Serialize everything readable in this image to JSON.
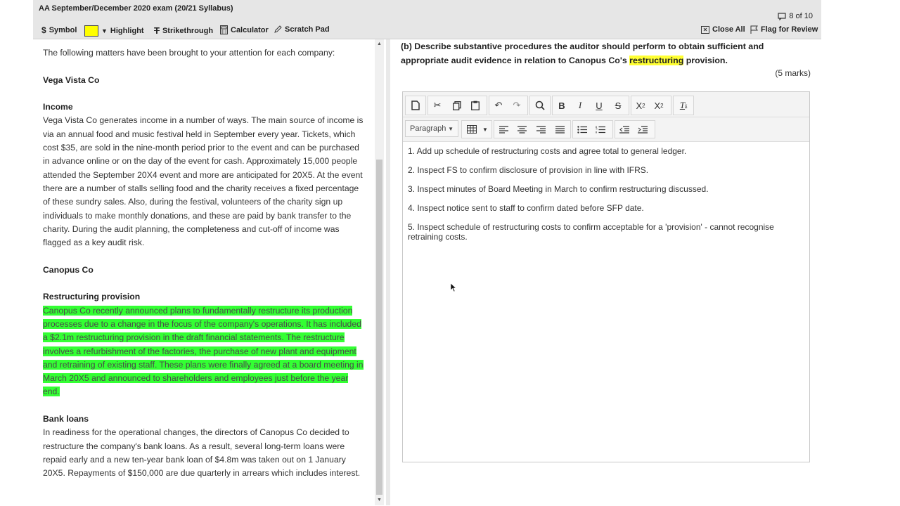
{
  "header": {
    "exam_title": "AA September/December 2020 exam (20/21 Syllabus)",
    "counter": "8 of 10"
  },
  "toolbar": {
    "symbol": "Symbol",
    "highlight": "Highlight",
    "highlight_color": "#ffff00",
    "strikethrough": "Strikethrough",
    "calculator": "Calculator",
    "scratch_pad": "Scratch Pad",
    "close_all": "Close All",
    "flag_for_review": "Flag for Review"
  },
  "left": {
    "intro": "The following matters have been brought to your attention for each company:",
    "company1": "Vega Vista Co",
    "income_heading": "Income",
    "income_text": "Vega Vista Co generates income in a number of ways. The main source of income is via an annual food and music festival held in September every year. Tickets, which cost $35, are sold in the nine-month period prior to the event and can be purchased in advance online or on the day of the event for cash. Approximately 15,000 people attended the September 20X4 event and more are anticipated for 20X5. At the event there are a number of stalls selling food and the charity receives a fixed percentage of these sundry sales. Also, during the festival, volunteers of the charity sign up individuals to make monthly donations, and these are paid by bank transfer to the charity. During the audit planning, the completeness and cut-off of income was flagged as a key audit risk.",
    "company2": "Canopus Co",
    "restructuring_heading": "Restructuring provision",
    "restructuring_text": "Canopus Co recently announced plans to fundamentally restructure its production processes due to a change in the focus of the company's operations. It has included a $2.1m restructuring provision in the draft financial statements. The restructure involves a refurbishment of the factories, the purchase of new plant and equipment and retraining of existing staff. These plans were finally agreed at a board meeting in March 20X5 and announced to shareholders and employees just before the year end.",
    "bank_heading": "Bank loans",
    "bank_text": "In readiness for the operational changes, the directors of Canopus Co decided to restructure the company's bank loans. As a result, several long-term loans were repaid early and a new ten-year bank loan of $4.8m was taken out on 1 January 20X5. Repayments of $150,000 are due quarterly in arrears which includes interest."
  },
  "question": {
    "part1": "(b) Describe substantive procedures the auditor should perform to obtain sufficient and appropriate audit evidence in relation to Canopus Co's ",
    "highlighted": "restructuring",
    "part2": " provision.",
    "marks": "(5 marks)"
  },
  "editor": {
    "format_value": "Paragraph",
    "answers": [
      "1. Add up schedule of restructuring costs and agree total to general ledger.",
      "2. Inspect FS to confirm disclosure of provision in line with IFRS.",
      "3. Inspect minutes of Board Meeting in March to confirm restructuring discussed.",
      "4. Inspect notice sent to staff to confirm dated before SFP date.",
      "5. Inspect schedule of restructuring costs to confirm acceptable for a 'provision' - cannot recognise retraining costs."
    ]
  }
}
